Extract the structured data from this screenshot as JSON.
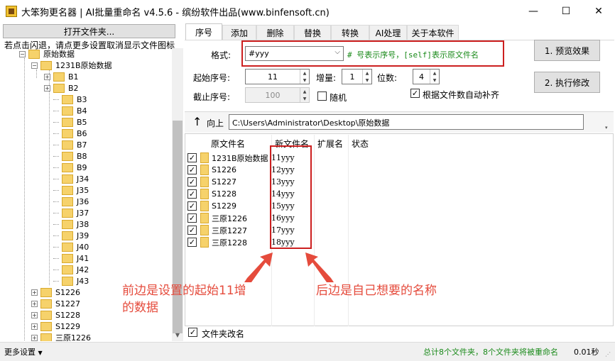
{
  "window": {
    "title": "大笨狗更名器 | AI批量重命名 v4.5.6 - 缤纷软件出品(www.binfensoft.cn)",
    "minimize": "—",
    "maximize": "☐",
    "close": "✕"
  },
  "left_panel": {
    "open_folder_label": "打开文件夹...",
    "hint": "若点击闪退，请点更多设置取消显示文件图标",
    "tree": {
      "root": "原始数据",
      "sub": "1231B原始数据",
      "sub_children": [
        "B1",
        "B2",
        "B3",
        "B4",
        "B5",
        "B6",
        "B7",
        "B8",
        "B9",
        "J34",
        "J35",
        "J36",
        "J37",
        "J38",
        "J39",
        "J40",
        "J41",
        "J42",
        "J43"
      ],
      "root_siblings": [
        "S1226",
        "S1227",
        "S1228",
        "S1229",
        "三原1226"
      ]
    }
  },
  "tabs": [
    {
      "label": "序号",
      "active": true
    },
    {
      "label": "添加"
    },
    {
      "label": "删除"
    },
    {
      "label": "替换"
    },
    {
      "label": "转换"
    },
    {
      "label": "AI处理"
    },
    {
      "label": "关于本软件"
    }
  ],
  "form": {
    "format_label": "格式:",
    "format_value": "#yyy",
    "format_hint": "# 号表示序号，[self]表示原文件名",
    "start_label": "起始序号:",
    "start_value": "11",
    "inc_label": "增量:",
    "inc_value": "1",
    "digits_label": "位数:",
    "digits_value": "4",
    "end_label": "截止序号:",
    "end_value": "100",
    "random_label": "随机",
    "random_checked": false,
    "autopad_label": "根据文件数自动补齐",
    "autopad_checked": true
  },
  "buttons": {
    "preview": "1. 预览效果",
    "execute": "2. 执行修改"
  },
  "path_bar": {
    "up_label": "向上",
    "path": "C:\\Users\\Administrator\\Desktop\\原始数据"
  },
  "file_list": {
    "columns": [
      "原文件名",
      "新文件名",
      "扩展名",
      "状态"
    ],
    "rows": [
      {
        "orig": "1231B原始数据",
        "new": "11yyy"
      },
      {
        "orig": "S1226",
        "new": "12yyy"
      },
      {
        "orig": "S1227",
        "new": "13yyy"
      },
      {
        "orig": "S1228",
        "new": "14yyy"
      },
      {
        "orig": "S1229",
        "new": "15yyy"
      },
      {
        "orig": "三原1226",
        "new": "16yyy"
      },
      {
        "orig": "三原1227",
        "new": "17yyy"
      },
      {
        "orig": "三原1228",
        "new": "18yyy"
      }
    ]
  },
  "annotations": {
    "left_line1": "前边是设置的起始11增",
    "left_line2": "的数据",
    "right": "后边是自己想要的名称",
    "color": "#e54b3c"
  },
  "rename_folder_label": "文件夹改名",
  "status": {
    "more_settings": "更多设置",
    "summary": "总计8个文件夹，8个文件夹将被重命名",
    "time": "0.01秒"
  }
}
